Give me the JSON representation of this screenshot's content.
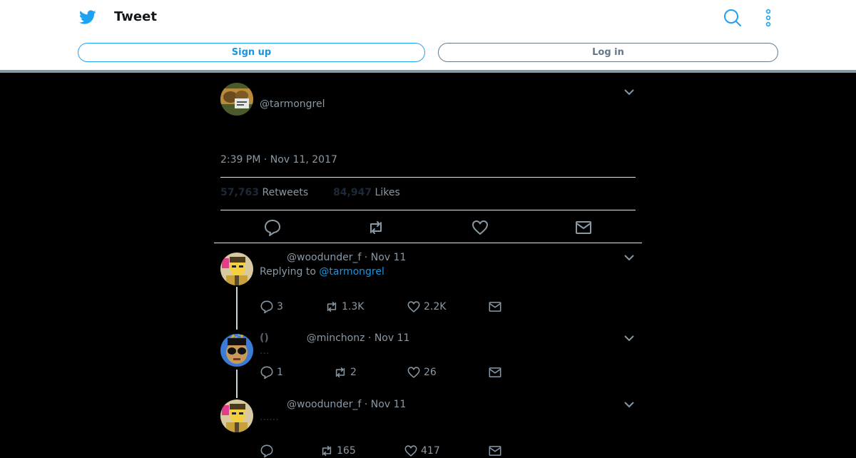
{
  "header": {
    "title": "Tweet",
    "signup_label": "Sign up",
    "login_label": "Log in"
  },
  "colors": {
    "accent": "#1da1f2",
    "muted": "#8899a6",
    "background": "#000000"
  },
  "tweet": {
    "handle": "@tarmongrel",
    "timestamp": "2:39 PM · Nov 11, 2017",
    "retweets": "57,763",
    "retweets_label": "Retweets",
    "likes": "84,947",
    "likes_label": "Likes"
  },
  "replies": [
    {
      "handle": "@woodunder_f",
      "date": "Nov 11",
      "replying_prefix": "Replying to",
      "replying_to": "@tarmongrel",
      "comments": "3",
      "retweets": "1.3K",
      "likes": "2.2K"
    },
    {
      "name": "()",
      "handle": "@minchonz",
      "date": "Nov 11",
      "text": "...",
      "comments": "1",
      "retweets": "2",
      "likes": "26"
    },
    {
      "handle": "@woodunder_f",
      "date": "Nov 11",
      "text": "......",
      "comments": "",
      "retweets": "165",
      "likes": "417"
    }
  ]
}
